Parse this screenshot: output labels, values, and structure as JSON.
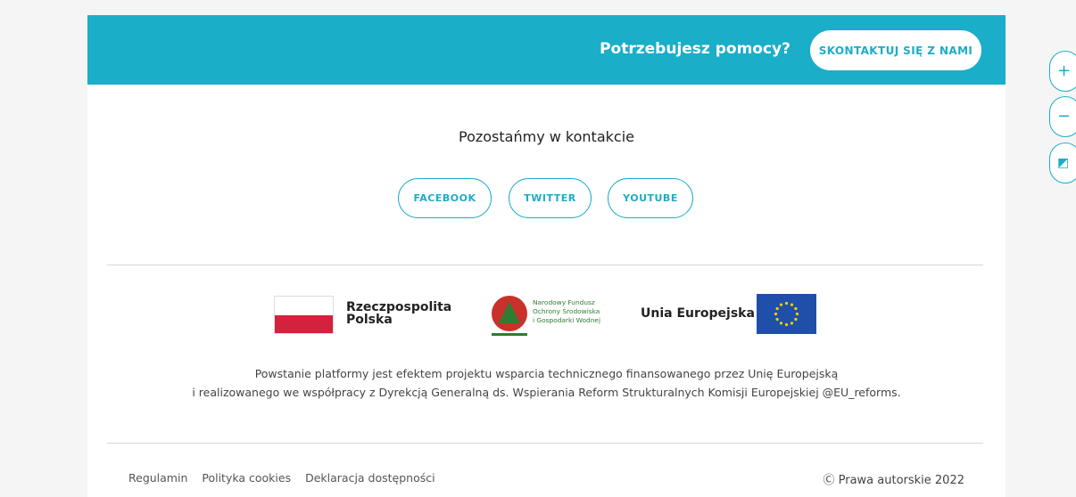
{
  "help_bar": {
    "question": "Potrzebujesz pomocy?",
    "contact_button": "SKONTAKTUJ SIĘ Z NAMI",
    "background_color": "#1aaec8"
  },
  "contact": {
    "title": "Pozostańmy w kontakcie",
    "social": [
      "FACEBOOK",
      "TWITTER",
      "YOUTUBE"
    ]
  },
  "logos": {
    "poland": {
      "line1": "Rzeczpospolita",
      "line2": "Polska"
    },
    "nfos": {
      "line1": "Narodowy Fundusz",
      "line2": "Ochrony Środowiska",
      "line3": "i Gospodarki Wodnej"
    },
    "eu": {
      "label": "Unia Europejska"
    }
  },
  "funding": {
    "line1": "Powstanie platformy jest efektem projektu wsparcia technicznego finansowanego przez Unię Europejską",
    "line2": "i realizowanego we współpracy z Dyrekcją Generalną ds. Wspierania Reform Strukturalnych Komisji Europejskiej @EU_reforms."
  },
  "footer": {
    "links": [
      "Regulamin",
      "Polityka cookies",
      "Deklaracja dostępności"
    ],
    "copyright": "Ⓒ Prawa autorskie 2022"
  },
  "side_tools": [
    {
      "icon": "zoom-in-icon",
      "glyph": "+"
    },
    {
      "icon": "zoom-out-icon",
      "glyph": "−"
    },
    {
      "icon": "contrast-icon",
      "glyph": "◩"
    }
  ]
}
